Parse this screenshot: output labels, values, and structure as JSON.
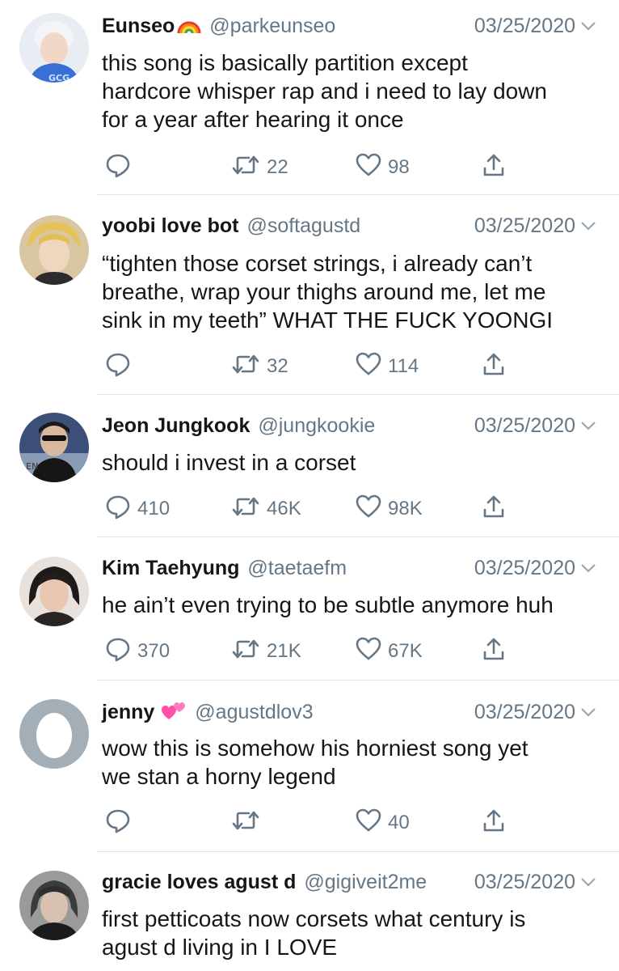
{
  "colors": {
    "muted": "#657786",
    "text": "#14171a",
    "divider": "#dfe3e6"
  },
  "tweets": [
    {
      "name": "Eunseo",
      "emoji": "rainbow-emoji",
      "handle": "@parkeunseo",
      "date": "03/25/2020",
      "text": "this song is basically partition except\nhardcore whisper rap and i need to lay down\nfor a year after hearing it once",
      "replies": "",
      "retweets": "22",
      "likes": "98"
    },
    {
      "name": "yoobi love bot",
      "handle": "@softagustd",
      "date": "03/25/2020",
      "text": "“tighten those corset strings, i already can’t\nbreathe, wrap your thighs around me, let me\nsink in my teeth” WHAT THE FUCK YOONGI",
      "replies": "",
      "retweets": "32",
      "likes": "114"
    },
    {
      "name": "Jeon Jungkook",
      "handle": "@jungkookie",
      "date": "03/25/2020",
      "text": "should i invest in a corset",
      "replies": "410",
      "retweets": "46K",
      "likes": "98K"
    },
    {
      "name": "Kim Taehyung",
      "handle": "@taetaefm",
      "date": "03/25/2020",
      "text": "he ain’t even trying to be subtle anymore huh",
      "replies": "370",
      "retweets": "21K",
      "likes": "67K"
    },
    {
      "name": "jenny",
      "emoji": "hearts-emoji",
      "handle": "@agustdlov3",
      "date": "03/25/2020",
      "text": "wow this is somehow his horniest song yet\nwe stan a horny legend",
      "replies": "",
      "retweets": "",
      "likes": "40"
    },
    {
      "name": "gracie loves agust d",
      "handle": "@gigiveit2me",
      "date": "03/25/2020",
      "text": "first petticoats now corsets what century is\nagust d living in I LOVE"
    }
  ]
}
